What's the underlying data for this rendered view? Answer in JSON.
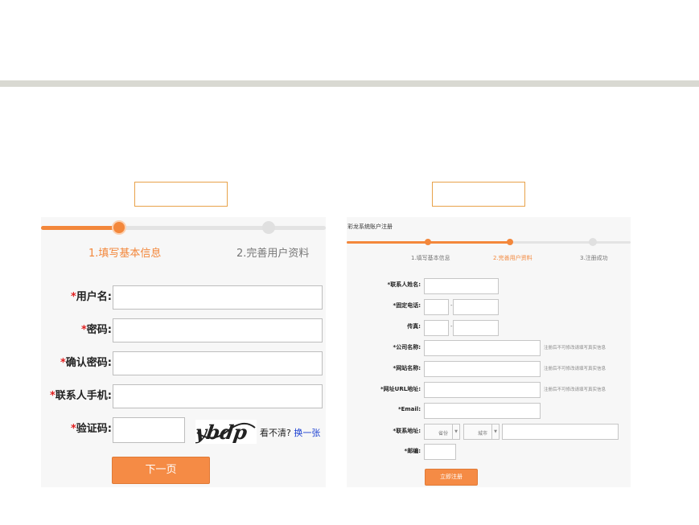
{
  "left_form": {
    "steps": [
      {
        "label": "1.填写基本信息",
        "state": "active"
      },
      {
        "label": "2.完善用户资料",
        "state": "inactive"
      }
    ],
    "required_mark": "*",
    "fields": [
      {
        "label": "用户名:",
        "value": ""
      },
      {
        "label": "密码:",
        "value": ""
      },
      {
        "label": "确认密码:",
        "value": ""
      },
      {
        "label": "联系人手机:",
        "value": ""
      },
      {
        "label": "验证码:",
        "value": ""
      }
    ],
    "captcha": {
      "image_text": "ybdp",
      "help_text": "看不清?",
      "refresh_link": "换一张"
    },
    "next_button": "下一页"
  },
  "right_form": {
    "title": "彩龙系统账户注册",
    "steps": [
      {
        "label": "1.填写基本信息",
        "state": "done"
      },
      {
        "label": "2.完善用户资料",
        "state": "active"
      },
      {
        "label": "3.注册成功",
        "state": "inactive"
      }
    ],
    "fields": {
      "contact_name": "*联系人姓名:",
      "phone": "*固定电话:",
      "fax": "传真:",
      "company": "*公司名称:",
      "site_name": "*网站名称:",
      "site_url": "*网址URL地址:",
      "email": "*Email:",
      "address": "*联系地址:",
      "postcode": "*邮编:"
    },
    "hint": "注册后不可修改请填写真实信息",
    "province_placeholder": "省份",
    "city_placeholder": "城市",
    "submit_button": "立即注册"
  },
  "colors": {
    "accent": "#f3873b",
    "required": "#e02020",
    "link": "#1a3fd1",
    "topbar": "#d9d9d2"
  }
}
